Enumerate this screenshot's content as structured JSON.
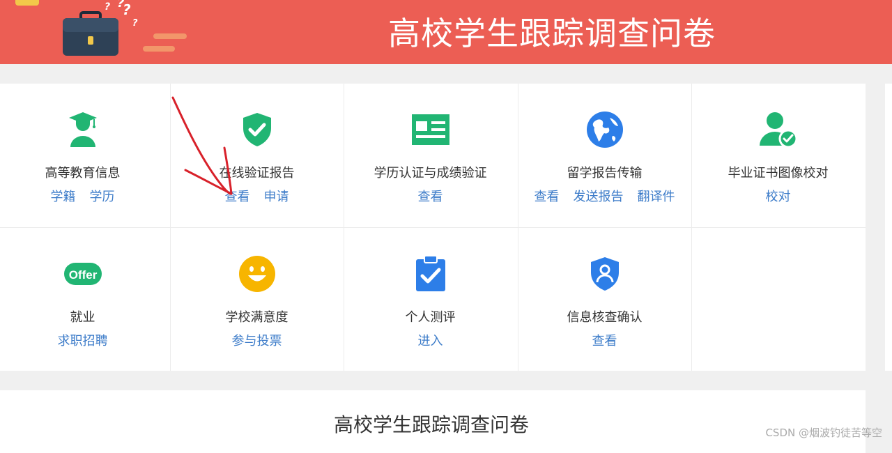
{
  "header": {
    "title": "高校学生跟踪调查问卷"
  },
  "colors": {
    "banner": "#ec5e54",
    "icon_green": "#21b573",
    "icon_blue": "#2d7ee8",
    "icon_yellow": "#f7b500",
    "link": "#3d7cc9",
    "annotation": "#d8212a"
  },
  "services": [
    {
      "title": "高等教育信息",
      "icon": "graduate-icon",
      "links": [
        "学籍",
        "学历"
      ]
    },
    {
      "title": "在线验证报告",
      "icon": "shield-check-icon",
      "links": [
        "查看",
        "申请"
      ]
    },
    {
      "title": "学历认证与成绩验证",
      "icon": "certificate-icon",
      "links": [
        "查看"
      ]
    },
    {
      "title": "留学报告传输",
      "icon": "globe-icon",
      "links": [
        "查看",
        "发送报告",
        "翻译件"
      ]
    },
    {
      "title": "毕业证书图像校对",
      "icon": "user-check-icon",
      "links": [
        "校对"
      ]
    },
    {
      "title": "就业",
      "icon": "offer-icon",
      "links": [
        "求职招聘"
      ]
    },
    {
      "title": "学校满意度",
      "icon": "smile-icon",
      "links": [
        "参与投票"
      ]
    },
    {
      "title": "个人测评",
      "icon": "clipboard-check-icon",
      "links": [
        "进入"
      ]
    },
    {
      "title": "信息核查确认",
      "icon": "shield-user-icon",
      "links": [
        "查看"
      ]
    }
  ],
  "icon_text": {
    "offer": "Offer"
  },
  "section": {
    "title": "高校学生跟踪调查问卷"
  },
  "watermark": "CSDN @烟波钓徒苦等空"
}
